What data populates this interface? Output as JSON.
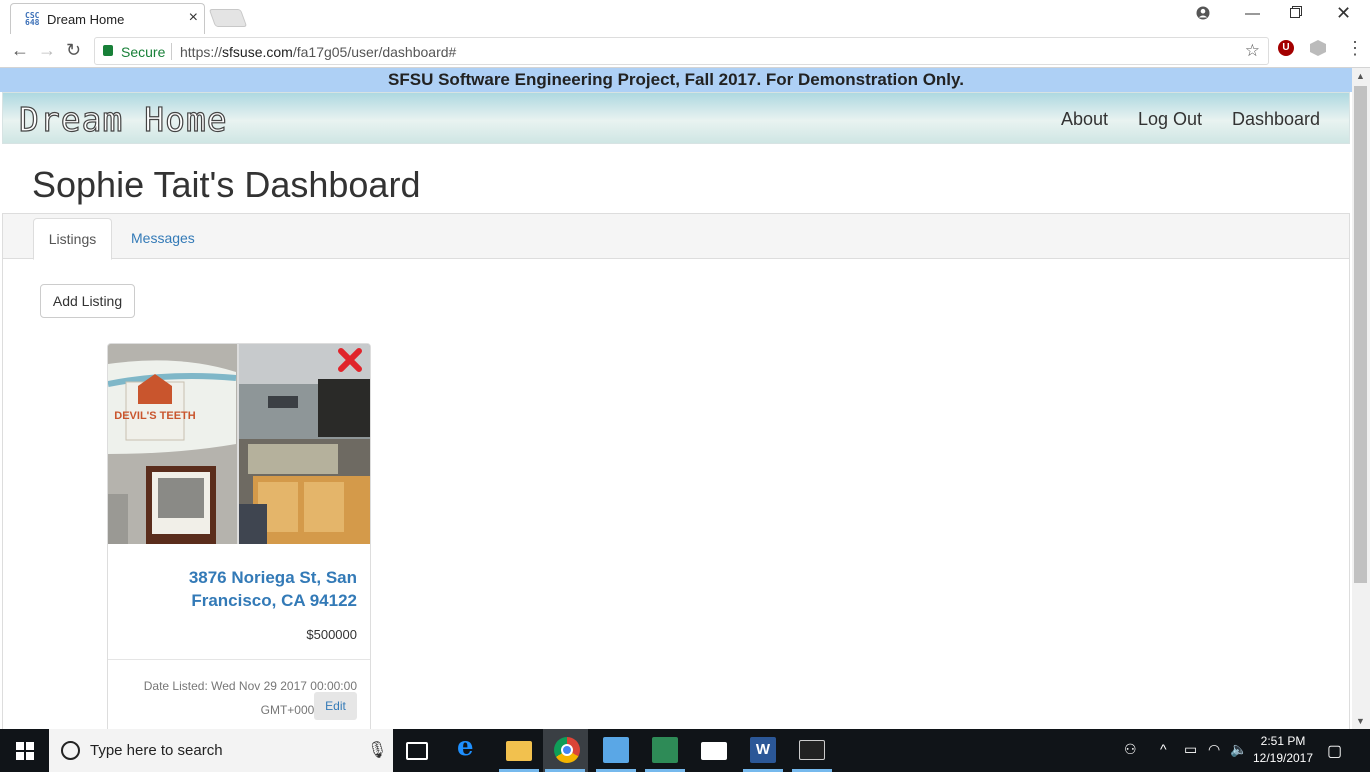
{
  "browser": {
    "tab_title": "Dream Home",
    "favicon_text": "CSC 648",
    "secure_label": "Secure",
    "url_prefix": "https://",
    "url_host": "sfsuse.com",
    "url_path": "/fa17g05/user/dashboard#"
  },
  "site": {
    "demo_banner": "SFSU Software Engineering Project, Fall 2017. For Demonstration Only.",
    "brand": "Dream Home",
    "nav": {
      "about": "About",
      "logout": "Log Out",
      "dashboard": "Dashboard"
    }
  },
  "dashboard": {
    "title": "Sophie Tait's Dashboard",
    "tabs": {
      "listings": "Listings",
      "messages": "Messages"
    },
    "add_listing_label": "Add Listing",
    "listings": [
      {
        "address": "3876 Noriega St, San Francisco, CA 94122",
        "price": "$500000",
        "date_listed": "Date Listed: Wed Nov 29 2017 00:00:00 GMT+0000 (UTC)",
        "edit_label": "Edit",
        "image_sign_text": "DEVIL'S TEETH"
      }
    ]
  },
  "taskbar": {
    "search_placeholder": "Type here to search",
    "time": "2:51 PM",
    "date": "12/19/2017"
  },
  "colors": {
    "banner_bg": "#aed0f5",
    "link_blue": "#337ab7",
    "delete_red": "#e0242b",
    "taskbar_bg": "#101418"
  }
}
